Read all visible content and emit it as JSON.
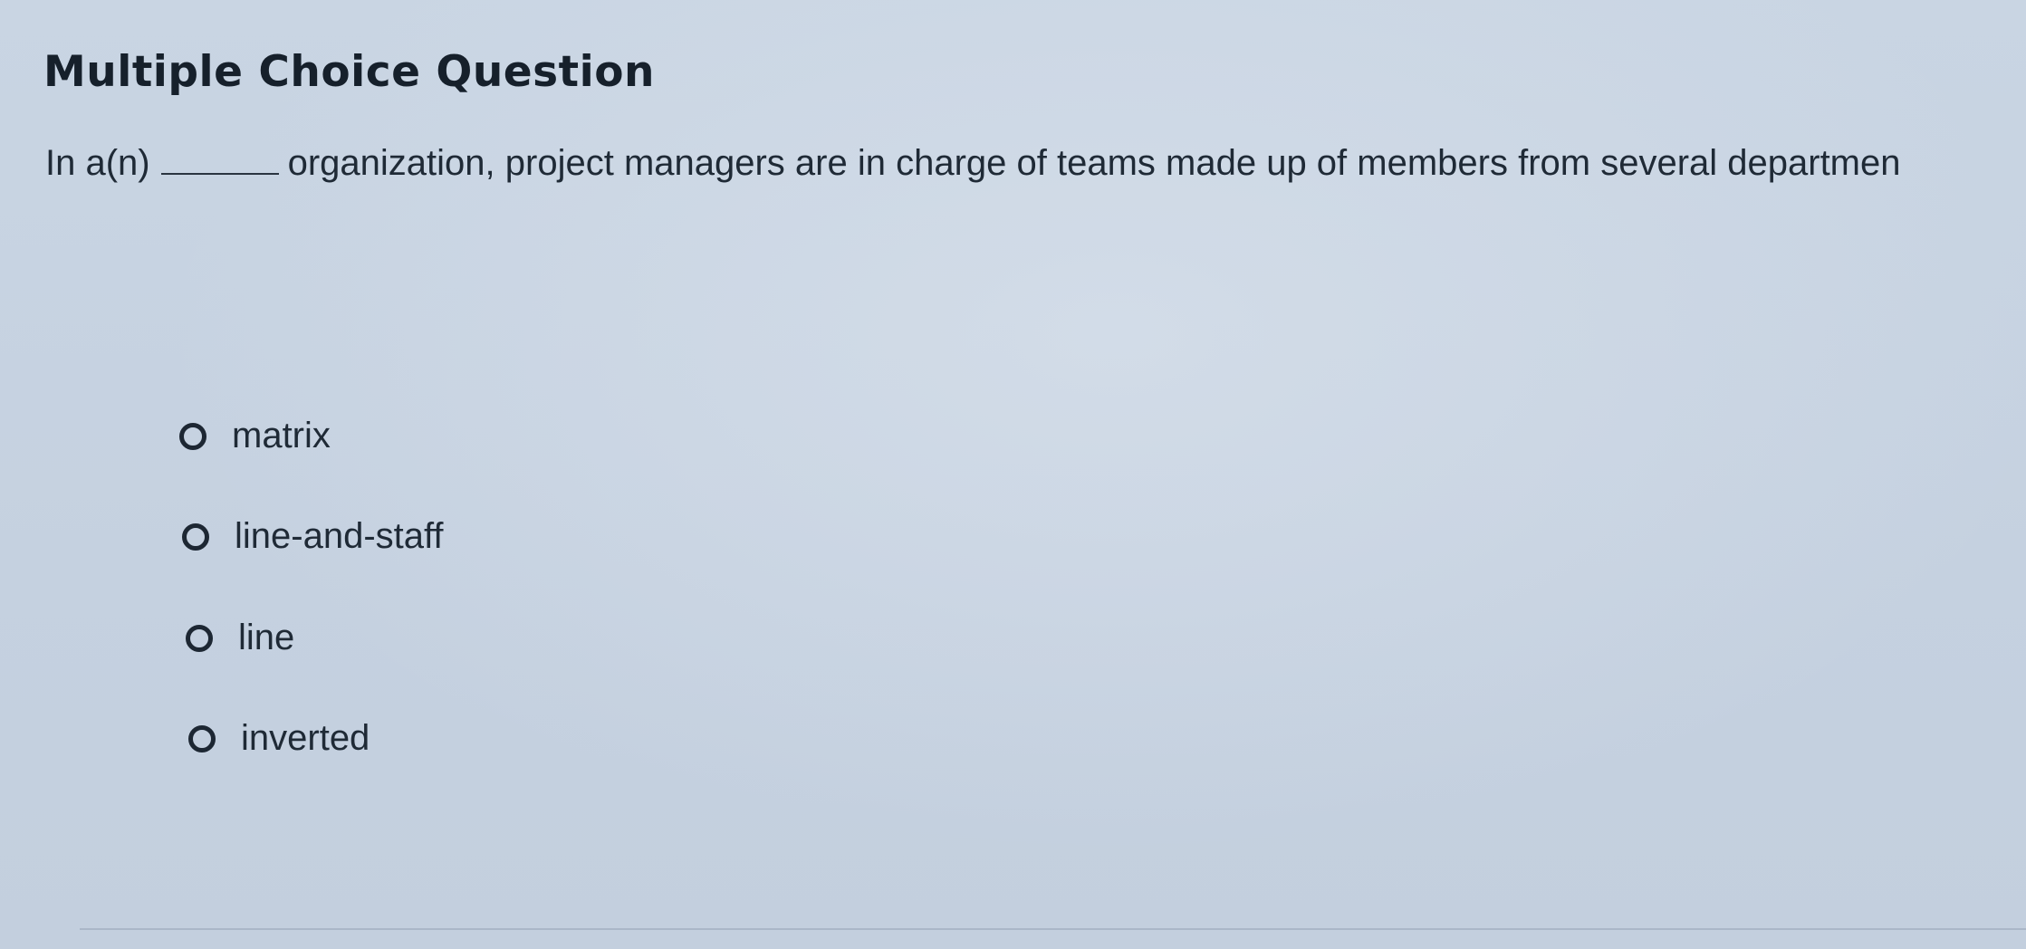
{
  "title": "Multiple Choice Question",
  "question": {
    "before_blank": "In a(n)",
    "after_blank": "organization, project managers are in charge of teams made up of members from several departmen"
  },
  "options": [
    {
      "label": "matrix",
      "selected": false
    },
    {
      "label": "line-and-staff",
      "selected": false
    },
    {
      "label": "line",
      "selected": false
    },
    {
      "label": "inverted",
      "selected": false
    }
  ]
}
